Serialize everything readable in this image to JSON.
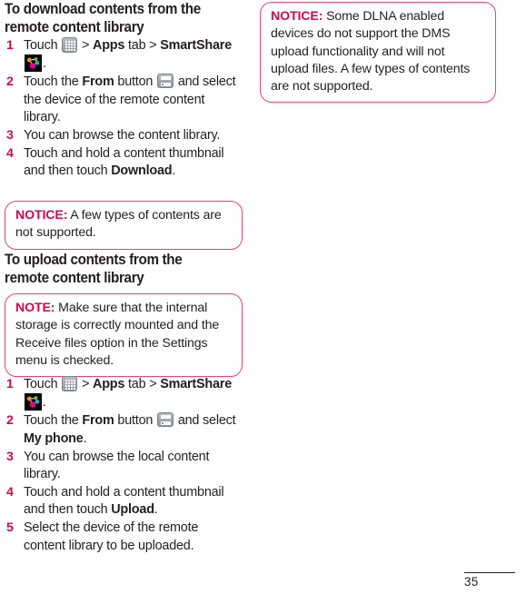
{
  "page": {
    "number": "35"
  },
  "colors": {
    "accent_magenta": "#cf0a4b",
    "callout_border": "#e4427d",
    "body_text": "#231f20",
    "icon_gray": "#939a9f"
  },
  "left_column": {
    "heading_download": "To download contents from the remote content library",
    "download_steps": [
      {
        "num": "1",
        "parts": [
          {
            "text": "Touch ",
            "bold": false
          },
          {
            "icon": "apps-grid-icon"
          },
          {
            "text": " > ",
            "bold": false
          },
          {
            "text": "Apps",
            "bold": true
          },
          {
            "text": " tab > ",
            "bold": false
          },
          {
            "text": "SmartShare",
            "bold": true
          },
          {
            "text": " ",
            "bold": false
          },
          {
            "icon": "smartshare-icon"
          },
          {
            "text": ".",
            "bold": false
          }
        ]
      },
      {
        "num": "2",
        "parts": [
          {
            "text": "Touch the ",
            "bold": false
          },
          {
            "text": "From",
            "bold": true
          },
          {
            "text": " button ",
            "bold": false
          },
          {
            "icon": "from-button-icon"
          },
          {
            "text": " and select the device of the remote content library.",
            "bold": false
          }
        ]
      },
      {
        "num": "3",
        "parts": [
          {
            "text": "You can browse the content library.",
            "bold": false
          }
        ]
      },
      {
        "num": "4",
        "parts": [
          {
            "text": "Touch and hold a content thumbnail and then touch ",
            "bold": false
          },
          {
            "text": "Download",
            "bold": true
          },
          {
            "text": ".",
            "bold": false
          }
        ]
      }
    ],
    "notice_download": {
      "label": "NOTICE:",
      "text": " A few types of contents are not supported."
    },
    "heading_upload": "To upload contents from the remote content library",
    "note_upload": {
      "label": "NOTE:",
      "text": " Make sure that the internal storage is correctly mounted and the Receive files option in the Settings menu is checked."
    },
    "upload_steps": [
      {
        "num": "1",
        "parts": [
          {
            "text": "Touch ",
            "bold": false
          },
          {
            "icon": "apps-grid-icon"
          },
          {
            "text": " > ",
            "bold": false
          },
          {
            "text": "Apps",
            "bold": true
          },
          {
            "text": " tab > ",
            "bold": false
          },
          {
            "text": "SmartShare",
            "bold": true
          },
          {
            "text": " ",
            "bold": false
          },
          {
            "icon": "smartshare-icon"
          },
          {
            "text": ".",
            "bold": false
          }
        ]
      },
      {
        "num": "2",
        "parts": [
          {
            "text": "Touch the ",
            "bold": false
          },
          {
            "text": "From",
            "bold": true
          },
          {
            "text": " button ",
            "bold": false
          },
          {
            "icon": "from-button-icon"
          },
          {
            "text": " and select ",
            "bold": false
          },
          {
            "text": "My phone",
            "bold": true
          },
          {
            "text": ".",
            "bold": false
          }
        ]
      },
      {
        "num": "3",
        "parts": [
          {
            "text": "You can browse the local content library.",
            "bold": false
          }
        ]
      },
      {
        "num": "4",
        "parts": [
          {
            "text": "Touch and hold a content thumbnail and then touch ",
            "bold": false
          },
          {
            "text": "Upload",
            "bold": true
          },
          {
            "text": ".",
            "bold": false
          }
        ]
      },
      {
        "num": "5",
        "parts": [
          {
            "text": "Select the device of the remote content library to be uploaded.",
            "bold": false
          }
        ]
      }
    ]
  },
  "right_column": {
    "notice_dlna": {
      "label": "NOTICE:",
      "text": " Some DLNA enabled devices do not support the DMS upload functionality and will not upload files. A few types of contents are not supported."
    }
  }
}
